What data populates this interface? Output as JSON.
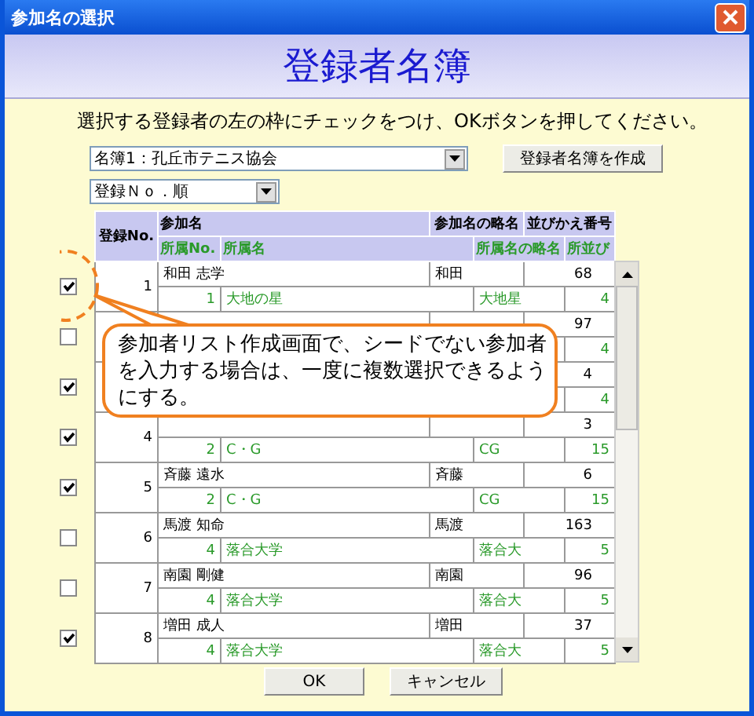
{
  "window": {
    "title": "参加名の選択"
  },
  "heading": "登録者名簿",
  "instruction": "選択する登録者の左の枠にチェックをつけ、OKボタンを押してください。",
  "roster_select": {
    "value": "名簿1：孔丘市テニス協会"
  },
  "create_button": "登録者名簿を作成",
  "sort_select": {
    "value": "登録Ｎｏ．順"
  },
  "table": {
    "columns": [
      "登録No.",
      "参加名",
      "参加名の略名",
      "並びかえ番号"
    ],
    "sub_columns": [
      "所属No.",
      "所属名",
      "所属名の略名",
      "所並び"
    ],
    "rows": [
      {
        "checked": true,
        "no": "1",
        "name": "和田 志学",
        "short": "和田",
        "order": "68",
        "div_no": "1",
        "div_name": "大地の星",
        "div_short": "大地星",
        "div_order": "4"
      },
      {
        "checked": false,
        "order": "97",
        "div_order": "4"
      },
      {
        "checked": true,
        "order": "4",
        "div_order": "4"
      },
      {
        "checked": true,
        "no": "4",
        "order": "3",
        "div_no": "2",
        "div_name": "C・G",
        "div_short": "CG",
        "div_order": "15"
      },
      {
        "checked": true,
        "no": "5",
        "name": "斉藤 遠水",
        "short": "斉藤",
        "order": "6",
        "div_no": "2",
        "div_name": "C・G",
        "div_short": "CG",
        "div_order": "15"
      },
      {
        "checked": false,
        "no": "6",
        "name": "馬渡 知命",
        "short": "馬渡",
        "order": "163",
        "div_no": "4",
        "div_name": "落合大学",
        "div_short": "落合大",
        "div_order": "5"
      },
      {
        "checked": false,
        "no": "7",
        "name": "南園 剛健",
        "short": "南園",
        "order": "96",
        "div_no": "4",
        "div_name": "落合大学",
        "div_short": "落合大",
        "div_order": "5"
      },
      {
        "checked": true,
        "no": "8",
        "name": "増田 成人",
        "short": "増田",
        "order": "37",
        "div_no": "4",
        "div_name": "落合大学",
        "div_short": "落合大",
        "div_order": "5"
      }
    ]
  },
  "callout": "参加者リスト作成画面で、シードでない参加者を入力する場合は、一度に複数選択できるようにする。",
  "buttons": [
    "OK",
    "キャンセル"
  ]
}
